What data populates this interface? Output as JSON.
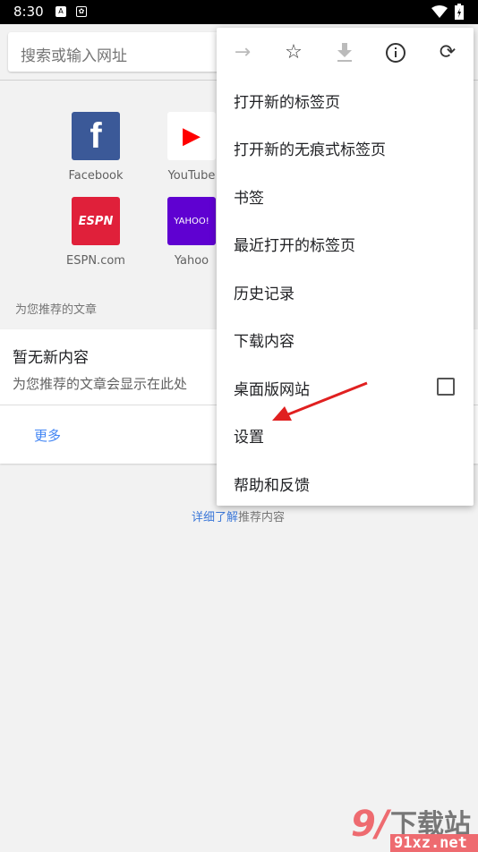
{
  "status_bar": {
    "time": "8:30"
  },
  "search": {
    "placeholder": "搜索或输入网址"
  },
  "tiles": [
    {
      "label": "Facebook",
      "glyph": "f",
      "color": "#3b5998"
    },
    {
      "label": "YouTube",
      "glyph": "▶",
      "color": "#ff0000"
    },
    {
      "label": "ESPN.com",
      "glyph": "ESPN",
      "color": "#e0203a"
    },
    {
      "label": "Yahoo",
      "glyph": "YAHOO!",
      "color": "#5f01d1"
    }
  ],
  "articles": {
    "section_label": "为您推荐的文章",
    "empty_title": "暂无新内容",
    "empty_subtitle": "为您推荐的文章会显示在此处",
    "more": "更多"
  },
  "learn_more": {
    "link": "详细了解",
    "text": "推荐内容"
  },
  "menu": {
    "icons": [
      "forward-icon",
      "bookmark-star-icon",
      "download-icon",
      "info-icon",
      "refresh-icon"
    ],
    "items": [
      "打开新的标签页",
      "打开新的无痕式标签页",
      "书签",
      "最近打开的标签页",
      "历史记录",
      "下载内容",
      "桌面版网站",
      "设置",
      "帮助和反馈"
    ],
    "desktop_site_checked": false
  },
  "watermark": {
    "text": "下载站",
    "domain": "91xz.net",
    "logo": "91"
  }
}
